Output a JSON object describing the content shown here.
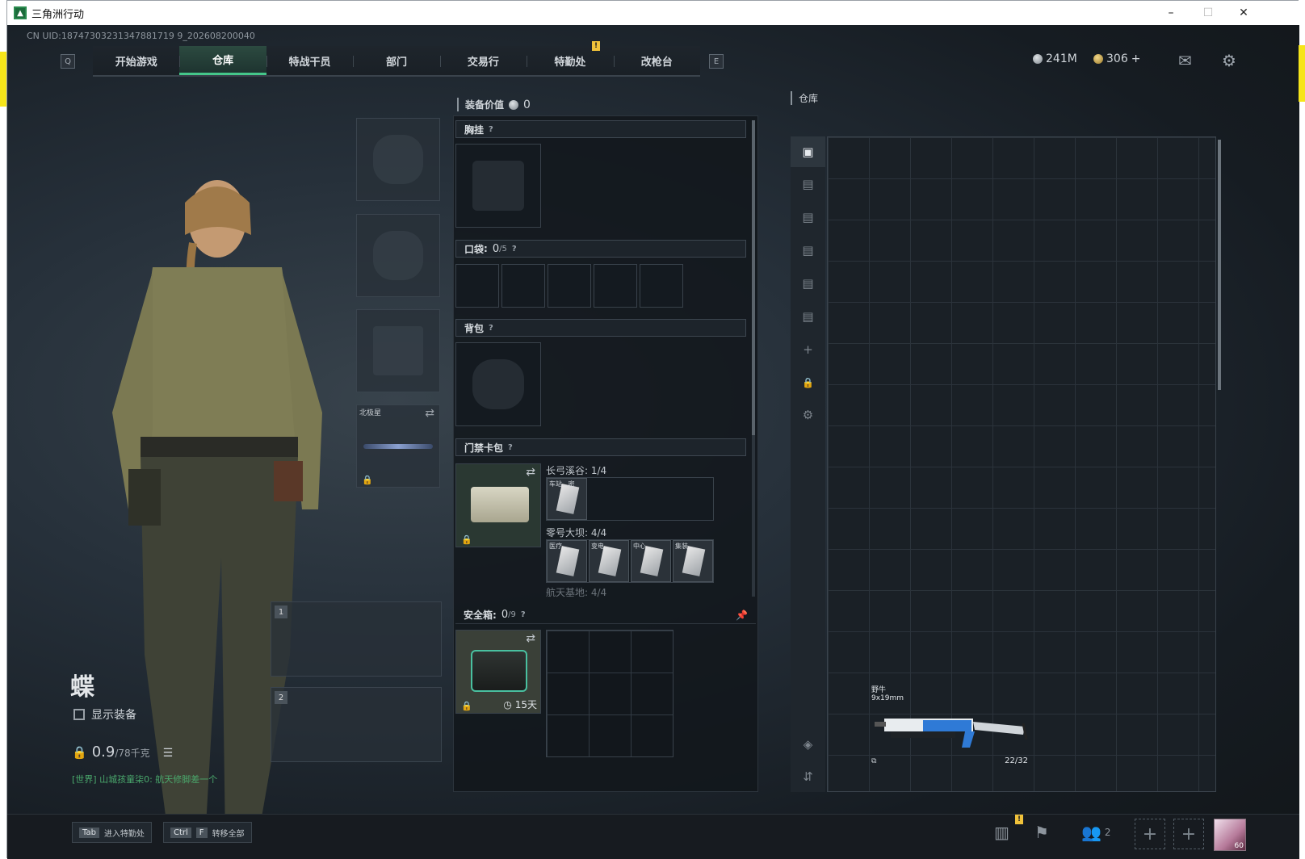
{
  "window": {
    "title": "三角洲行动",
    "minimize": "–",
    "maximize": "☐",
    "close": "✕"
  },
  "uid": "CN UID:18747303231347881719 9_202608200040",
  "nav": {
    "left_key": "Q",
    "right_key": "E",
    "items": [
      "开始游戏",
      "仓库",
      "特战干员",
      "部门",
      "交易行",
      "特勤处",
      "改枪台"
    ],
    "active": "仓库",
    "warn": "!"
  },
  "currency": {
    "silver": "241M",
    "gold": "306",
    "gold_add": "+"
  },
  "icons": {
    "mail": "mail-icon",
    "settings": "gear-icon"
  },
  "character": {
    "name": "蝶",
    "show_gear": "显示装备",
    "weight": "0.9",
    "weight_max": "/78千克",
    "chat": "[世界] 山城孩童柒0: 航天修脚差一个"
  },
  "gear_slots": {
    "melee_label": "北极星"
  },
  "weapon_slots": [
    "1",
    "2"
  ],
  "loadout": {
    "equipment_value_label": "装备价值",
    "equipment_value": "0",
    "chest_rig": "胸挂",
    "pockets_label": "口袋",
    "pockets_used": "0",
    "pockets_total": "/5",
    "backpack": "背包",
    "keycard_case": "门禁卡包",
    "keycard_sections": [
      {
        "label": "长弓溪谷: 1/4",
        "cards": [
          "车站...密"
        ]
      },
      {
        "label": "零号大坝: 4/4",
        "cards": [
          "医疗...",
          "变电...",
          "中心...",
          "集装..."
        ]
      },
      {
        "label": "航天基地: 4/4",
        "cards": []
      }
    ],
    "safe_box_label": "安全箱",
    "safe_used": "0",
    "safe_total": "/9",
    "safe_days": "15天",
    "help": "?"
  },
  "stash": {
    "title": "仓库",
    "item_name": "野牛",
    "item_caliber": "9x19mm",
    "item_ammo": "22/32"
  },
  "bottom": {
    "tab_key": "Tab",
    "tab_label": "进入特勤处",
    "ctrl_key": "Ctrl",
    "f_key": "F",
    "transfer_label": "转移全部",
    "friends_count": "2",
    "avatar_level": "60"
  }
}
